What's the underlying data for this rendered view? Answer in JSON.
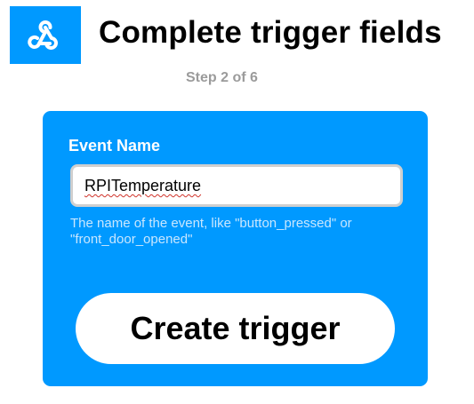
{
  "header": {
    "service_icon": "webhooks-icon",
    "title": "Complete trigger fields",
    "step": "Step 2 of 6"
  },
  "form": {
    "event_name": {
      "label": "Event Name",
      "value": "RPITemperature",
      "helper": "The name of the event, like \"button_pressed\" or \"front_door_opened\""
    },
    "submit_label": "Create trigger"
  },
  "colors": {
    "brand_blue": "#0099ff",
    "step_gray": "#9b9b9b",
    "helper_text": "#c9e7ff"
  }
}
